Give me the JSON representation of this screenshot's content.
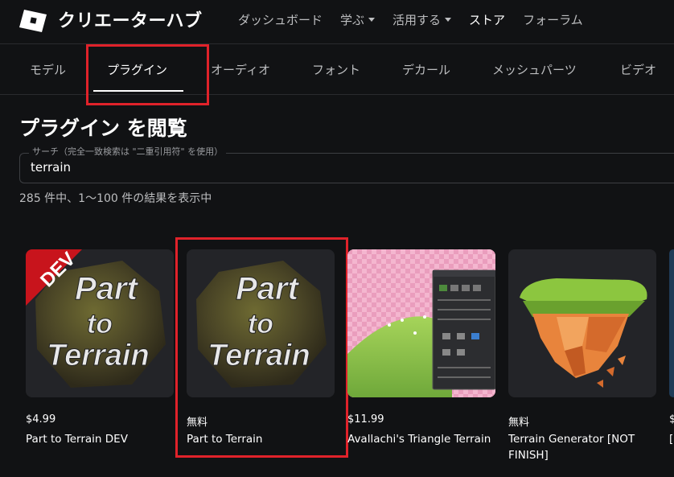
{
  "header": {
    "brand": "クリエーターハブ",
    "nav": [
      {
        "label": "ダッシュボード",
        "dropdown": false,
        "active": false
      },
      {
        "label": "学ぶ",
        "dropdown": true,
        "active": false
      },
      {
        "label": "活用する",
        "dropdown": true,
        "active": false
      },
      {
        "label": "ストア",
        "dropdown": false,
        "active": true
      },
      {
        "label": "フォーラム",
        "dropdown": false,
        "active": false
      }
    ]
  },
  "tabs": [
    "モデル",
    "プラグイン",
    "オーディオ",
    "フォント",
    "デカール",
    "メッシュパーツ",
    "ビデオ"
  ],
  "selected_tab": "プラグイン",
  "page": {
    "title": "プラグイン を閲覧",
    "search_label": "サーチ（完全一致検索は \"二重引用符\" を使用）",
    "search_value": "terrain",
    "result_count": "285 件中、1～100 件の結果を表示中"
  },
  "cards": [
    {
      "price": "$4.99",
      "name": "Part to Terrain DEV",
      "badge": "DEV",
      "thumb_text": [
        "Part",
        "to",
        "Terrain"
      ]
    },
    {
      "price": "無料",
      "name": "Part to Terrain",
      "thumb_text": [
        "Part",
        "to",
        "Terrain"
      ]
    },
    {
      "price": "$11.99",
      "name": "Avallachi's Triangle Terrain"
    },
    {
      "price": "無料",
      "name": "Terrain Generator [NOT FINISH]"
    },
    {
      "price": "$",
      "name": "["
    }
  ],
  "colors": {
    "highlight": "#e0222a",
    "background": "#111214",
    "card": "#232428"
  }
}
